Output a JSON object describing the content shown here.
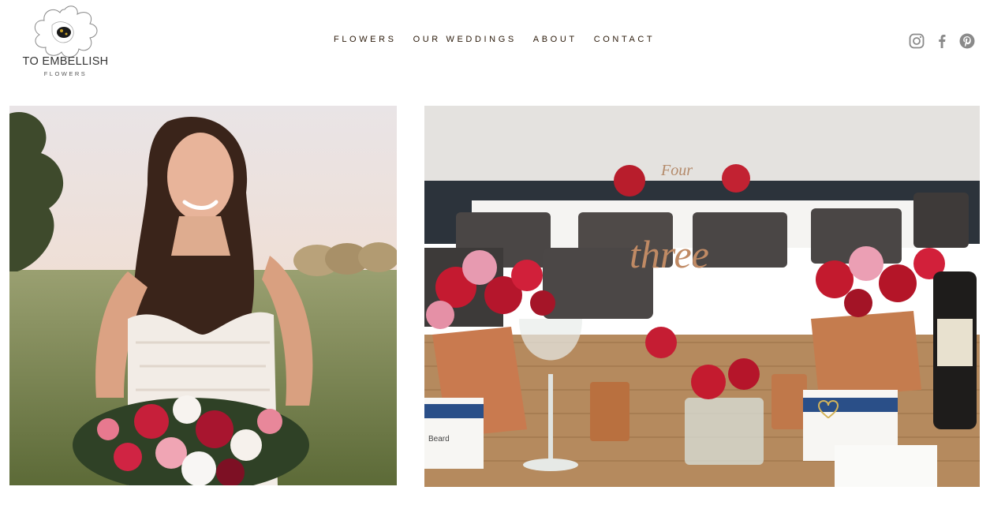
{
  "brand": {
    "title": "TO EMBELLISH",
    "subtitle": "FLOWERS"
  },
  "nav": {
    "items": [
      {
        "label": "FLOWERS"
      },
      {
        "label": "OUR WEDDINGS"
      },
      {
        "label": "ABOUT"
      },
      {
        "label": "CONTACT"
      }
    ]
  },
  "social": {
    "icons": [
      "instagram-icon",
      "facebook-icon",
      "pinterest-icon"
    ],
    "color": "#8a8a8a"
  },
  "colors": {
    "nav_text": "#2b1a0a",
    "background": "#ffffff"
  },
  "table_sign": "three",
  "back_table_sign": "Four",
  "place_card_name": "Beard"
}
